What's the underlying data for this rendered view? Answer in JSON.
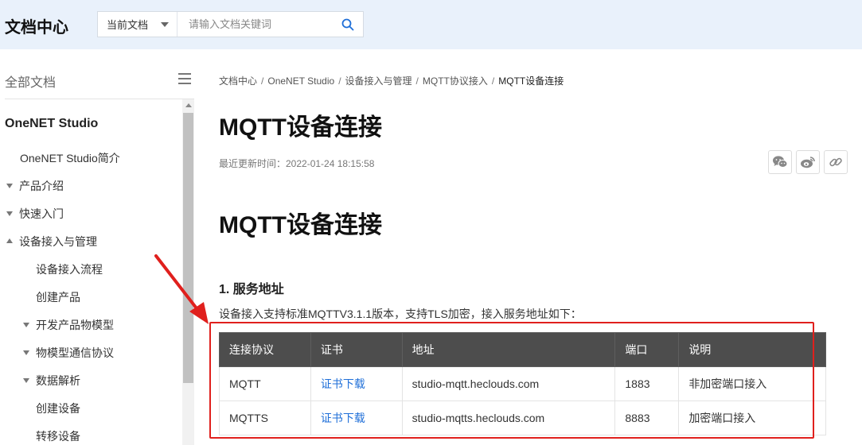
{
  "header": {
    "brand": "文档中心",
    "scope_label": "当前文档",
    "search_placeholder": "请输入文档关键词"
  },
  "sidebar": {
    "title": "全部文档",
    "section": "OneNET Studio",
    "items": [
      {
        "label": "OneNET Studio简介"
      },
      {
        "label": "产品介绍"
      },
      {
        "label": "快速入门"
      },
      {
        "label": "设备接入与管理"
      },
      {
        "label": "设备接入流程"
      },
      {
        "label": "创建产品"
      },
      {
        "label": "开发产品物模型"
      },
      {
        "label": "物模型通信协议"
      },
      {
        "label": "数据解析"
      },
      {
        "label": "创建设备"
      },
      {
        "label": "转移设备"
      }
    ]
  },
  "breadcrumb": [
    "文档中心",
    "OneNET Studio",
    "设备接入与管理",
    "MQTT协议接入",
    "MQTT设备连接"
  ],
  "breadcrumb_sep": "/",
  "article": {
    "title": "MQTT设备连接",
    "updated": "最近更新时间：2022-01-24 18:15:58",
    "heading": "MQTT设备连接",
    "section_title": "1. 服务地址",
    "intro": "设备接入支持标准MQTTV3.1.1版本，支持TLS加密，接入服务地址如下："
  },
  "share_icons": [
    "wechat-icon",
    "weibo-icon",
    "link-icon"
  ],
  "table": {
    "headers": [
      "连接协议",
      "证书",
      "地址",
      "端口",
      "说明"
    ],
    "rows": [
      [
        "MQTT",
        "证书下载",
        "studio-mqtt.heclouds.com",
        "1883",
        "非加密端口接入"
      ],
      [
        "MQTTS",
        "证书下载",
        "studio-mqtts.heclouds.com",
        "8883",
        "加密端口接入"
      ]
    ]
  },
  "colors": {
    "header_bg": "#e9f1fb",
    "table_header_bg": "#4d4d4d",
    "link": "#1f6fd8",
    "annotation_red": "#e0201d"
  }
}
